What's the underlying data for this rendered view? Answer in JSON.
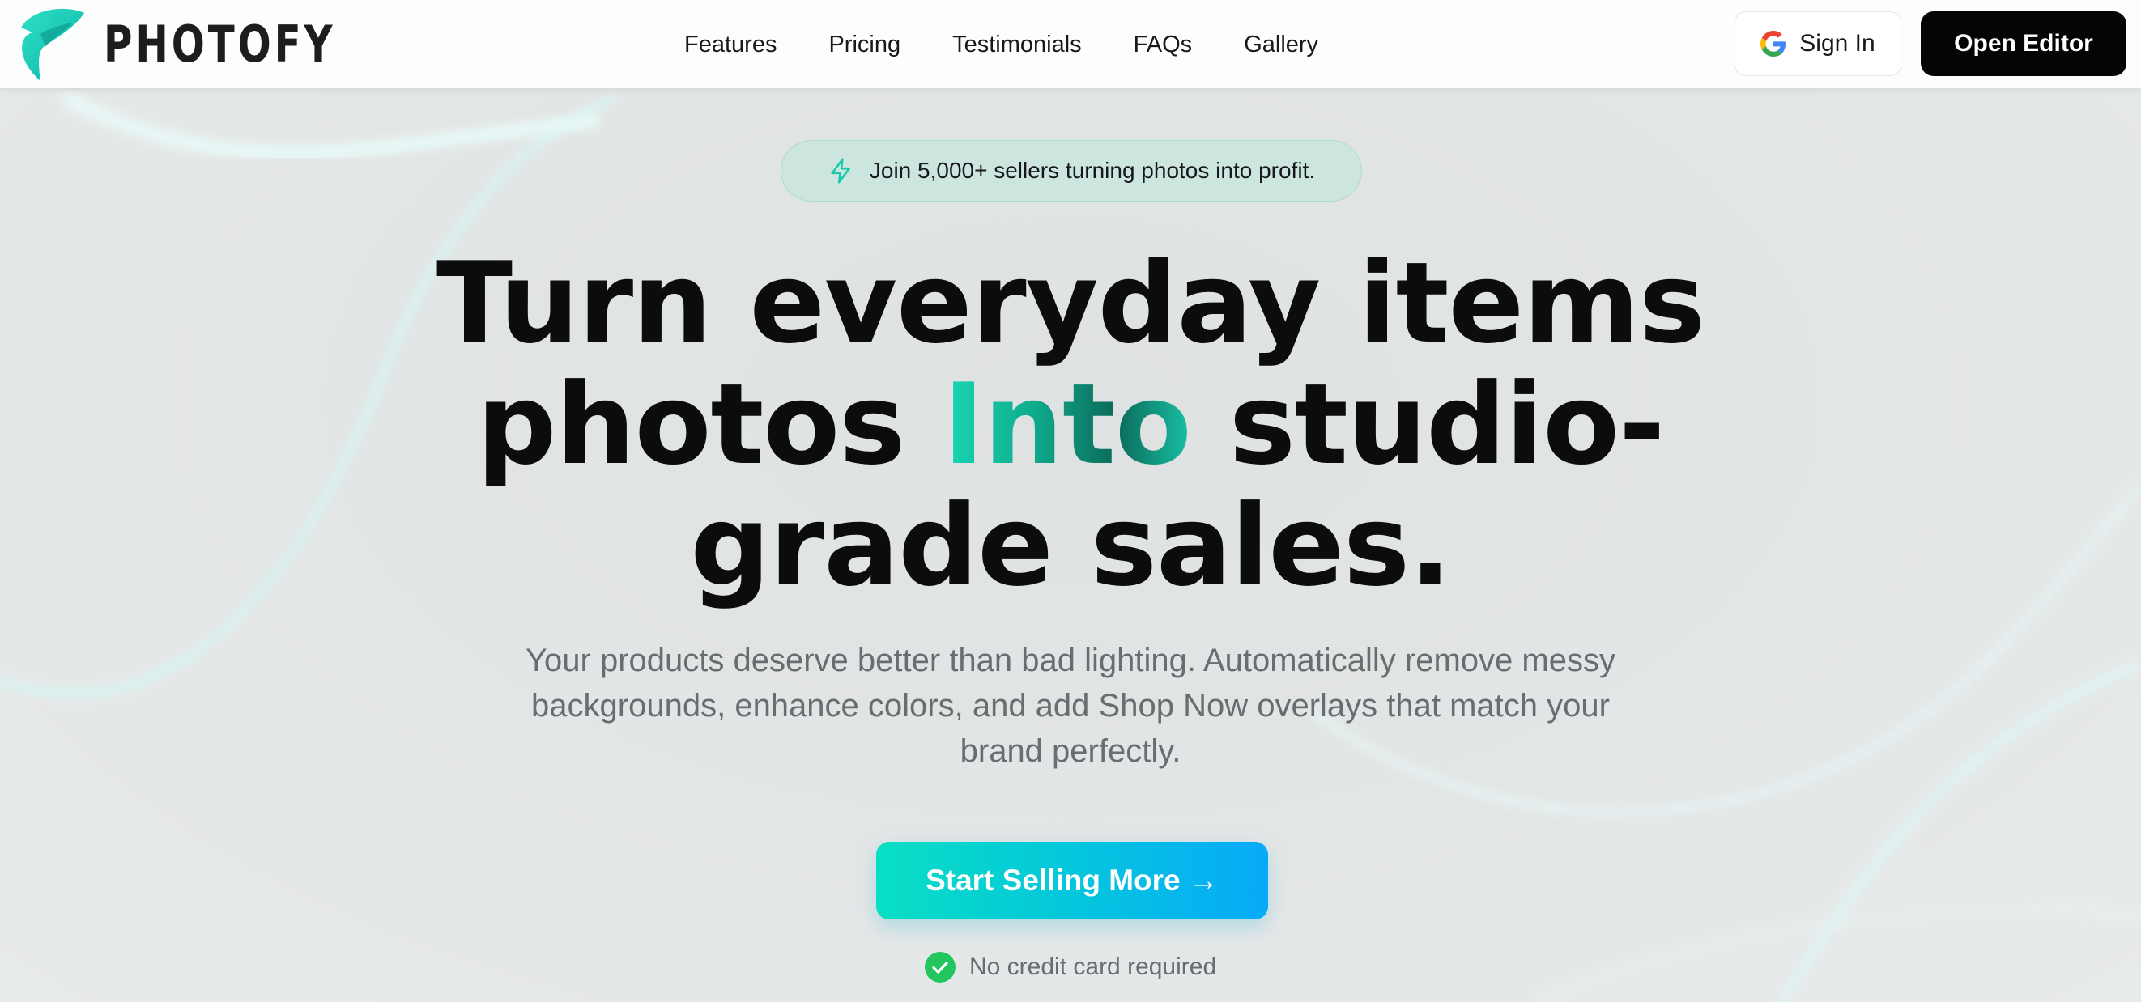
{
  "brand": {
    "name": "PHOTOFY",
    "logo_icon": "photofy-logo-icon",
    "accent": "#17d3b5"
  },
  "nav": {
    "items": [
      {
        "label": "Features"
      },
      {
        "label": "Pricing"
      },
      {
        "label": "Testimonials"
      },
      {
        "label": "FAQs"
      },
      {
        "label": "Gallery"
      }
    ]
  },
  "header_actions": {
    "signin_label": "Sign In",
    "signin_icon": "google-icon",
    "editor_label": "Open Editor"
  },
  "hero": {
    "announcement": "Join 5,000+ sellers turning photos into profit.",
    "announcement_icon": "bolt-icon",
    "headline_line1": "Turn everyday items",
    "headline_pre": "photos ",
    "headline_highlight": "Into",
    "headline_post": " studio-",
    "headline_line3": "grade sales.",
    "subtitle": "Your products deserve better than bad lighting. Automatically remove messy backgrounds, enhance colors, and add Shop Now overlays that match your brand perfectly.",
    "cta_label": "Start Selling More →",
    "note": "No credit card required",
    "note_icon": "check-circle-icon"
  },
  "colors": {
    "cta_gradient_start": "#08dfc4",
    "cta_gradient_end": "#07aaf9",
    "check_green": "#22c55e",
    "headline": "#0c0c0c"
  }
}
